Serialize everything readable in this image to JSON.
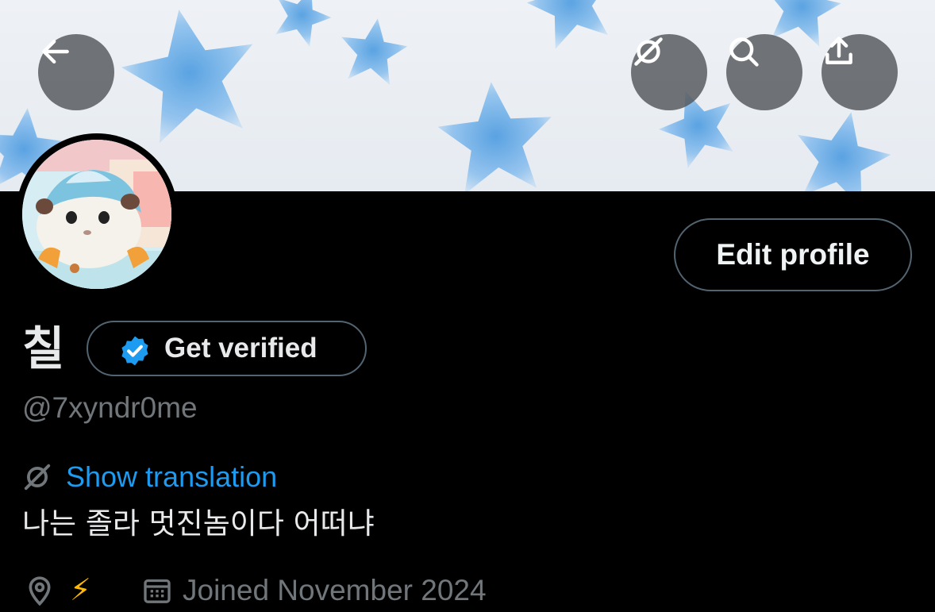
{
  "header": {
    "back_icon": "arrow-left-icon",
    "translate_icon": "no-translate-icon",
    "search_icon": "search-icon",
    "share_icon": "share-upload-icon"
  },
  "profile": {
    "edit_button_label": "Edit profile",
    "display_name": "칠",
    "verify_label": "Get verified",
    "handle": "@7xyndr0me",
    "show_translation_label": "Show translation",
    "bio": "나는 졸라 멋진놈이다 어떠냐",
    "location": "⚡",
    "joined": "Joined November 2024"
  },
  "colors": {
    "accent": "#1d9bf0",
    "muted": "#71767b",
    "border": "#536471",
    "background": "#000000"
  }
}
